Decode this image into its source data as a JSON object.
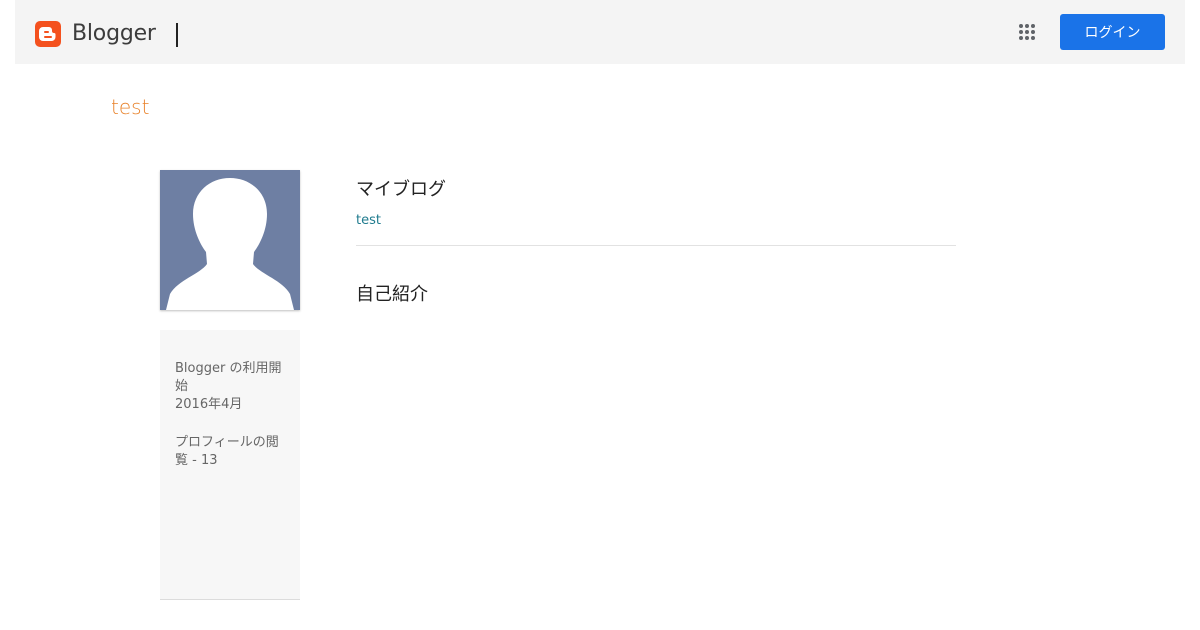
{
  "header": {
    "brand_name": "Blogger",
    "brand_color": "#f4511e",
    "apps_icon": "apps-grid-icon",
    "login_label": "ログイン",
    "login_color": "#1a73e8"
  },
  "blog": {
    "title": "test",
    "title_color": "#e8822a"
  },
  "profile": {
    "avatar_icon": "default-profile-silhouette",
    "started_label": "Blogger の利用開始",
    "started_date": "2016年4月",
    "views_label": "プロフィールの閲覧 - 13"
  },
  "main": {
    "my_blogs_heading": "マイブログ",
    "blogs": [
      {
        "name": "test"
      }
    ],
    "about_heading": "自己紹介"
  }
}
